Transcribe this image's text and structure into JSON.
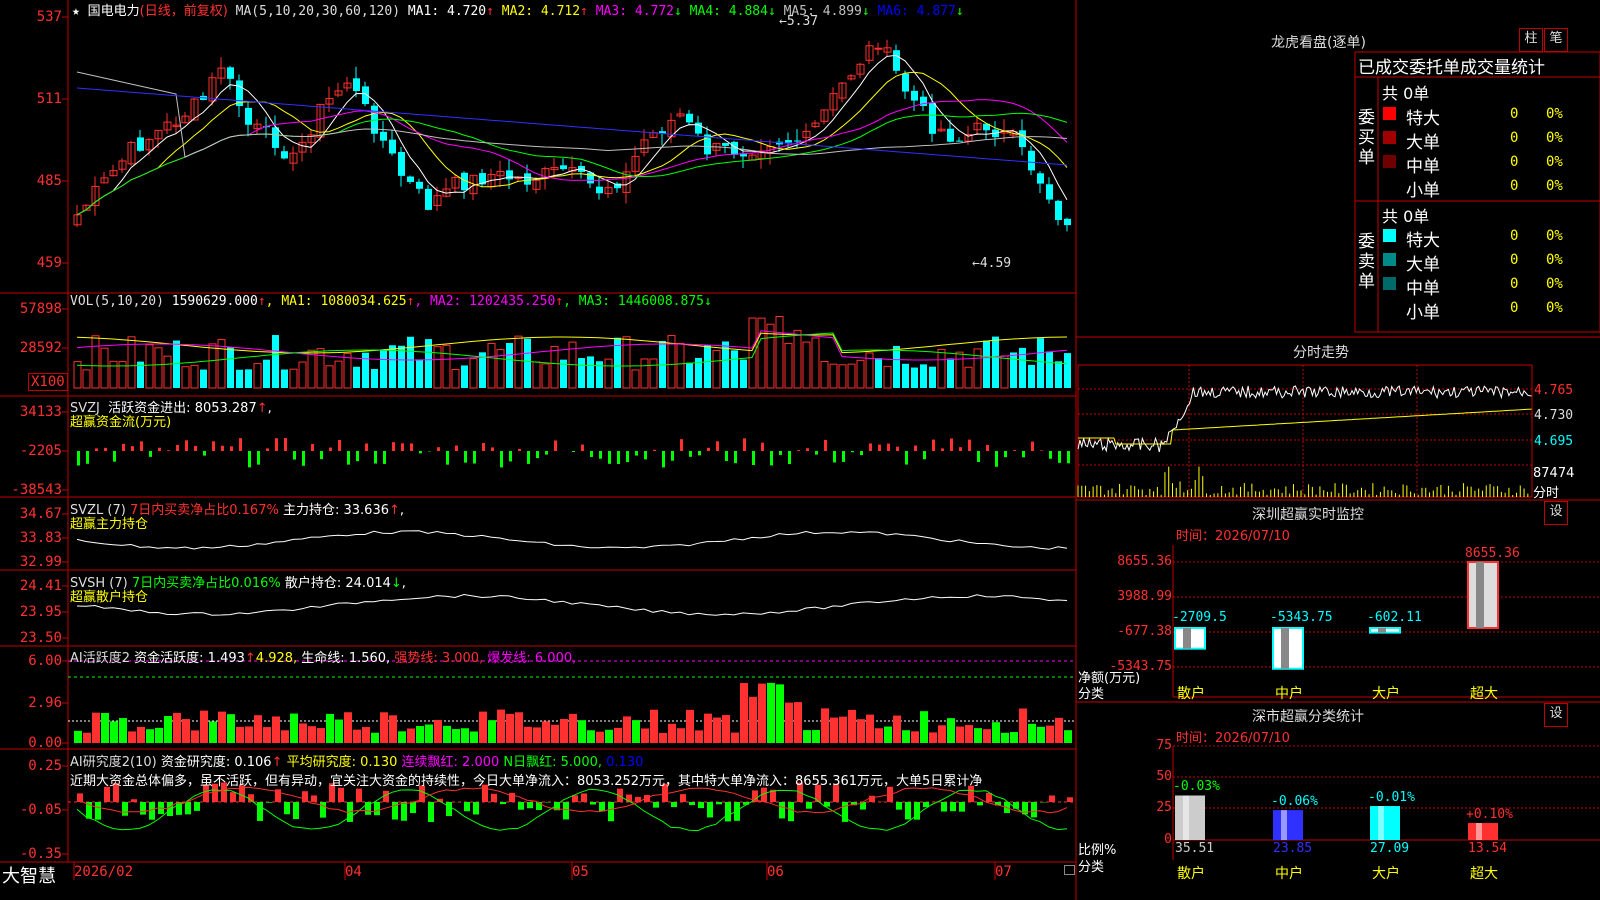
{
  "main_chart": {
    "star_icon": "★",
    "name": "国电电力",
    "period": "(日线，前复权)",
    "ma_params": "MA(5,10,20,30,60,120)",
    "ma": [
      {
        "label": "MA1:",
        "value": "4.720",
        "arrow": "↑",
        "color": "#ffffff"
      },
      {
        "label": "MA2:",
        "value": "4.712",
        "arrow": "↑",
        "color": "#ffff00"
      },
      {
        "label": "MA3:",
        "value": "4.772",
        "arrow": "↓",
        "color": "#ff00ff"
      },
      {
        "label": "MA4:",
        "value": "4.884",
        "arrow": "↓",
        "color": "#00ff00"
      },
      {
        "label": "MA5:",
        "value": "4.899",
        "arrow": "↓",
        "color": "#c0c0c0"
      },
      {
        "label": "MA6:",
        "value": "4.877",
        "arrow": "↓",
        "color": "#0000ff"
      }
    ],
    "high_note": "←5.37",
    "low_note": "←4.59",
    "yticks": [
      "537",
      "511",
      "485",
      "459"
    ]
  },
  "vol": {
    "params": "VOL(5,10,20)",
    "value": "1590629.000",
    "arrow": "↑",
    "ma": [
      {
        "label": "MA1:",
        "value": "1080034.625",
        "arrow": "↑",
        "color": "#ffff00"
      },
      {
        "label": "MA2:",
        "value": "1202435.250",
        "arrow": "↑",
        "color": "#ff00ff"
      },
      {
        "label": "MA3:",
        "value": "1446008.875",
        "arrow": "↓",
        "color": "#00ff00"
      }
    ],
    "yticks": [
      "57898",
      "28592"
    ],
    "unit": "X100"
  },
  "svzj": {
    "name": "SVZJ",
    "label": "活跃资金进出:",
    "value": "8053.287",
    "arrow": "↑",
    "tail": ",",
    "sub": "超赢资金流(万元)",
    "yticks": [
      "34133",
      "-2205",
      "-38543"
    ]
  },
  "svzl": {
    "name": "SVZL (7)",
    "ratio_label": "7日内买卖净占比0.167%",
    "label": "主力持仓:",
    "value": "33.636",
    "arrow": "↑",
    "tail": ",",
    "sub": "超赢主力持仓",
    "yticks": [
      "34.67",
      "33.83",
      "32.99"
    ]
  },
  "svsh": {
    "name": "SVSH (7)",
    "ratio_label": "7日内买卖净占比0.016%",
    "label": "散户持仓:",
    "value": "24.014",
    "arrow": "↓",
    "tail": ",",
    "sub": "超赢散户持仓",
    "yticks": [
      "24.41",
      "23.95",
      "23.50"
    ]
  },
  "ai_active": {
    "name": "AI活跃度2",
    "label": "资金活跃度:",
    "value": "1.493",
    "arrow": "↑",
    "value2": "4.928,",
    "life_label": "生命线:",
    "life_value": "1.560,",
    "strong_label": "强势线:",
    "strong_value": "3.000,",
    "burst_label": "爆发线:",
    "burst_value": "6.000,",
    "yticks": [
      "6.00",
      "2.96",
      "0.00"
    ]
  },
  "ai_research": {
    "name": "AI研究度2(10)",
    "label": "资金研究度:",
    "value": "0.106",
    "arrow": "↑",
    "avg_label": "平均研究度:",
    "avg_value": "0.130",
    "red_label": "连续飘红:",
    "red_value": "2.000",
    "nred_label": "N日飘红:",
    "nred_value": "5.000,",
    "nred_extra": "0.130",
    "comment": "近期大资金总体偏多，虽不活跃，但有异动，宜关注大资金的持续性，今日大单净流入：8053.252万元，其中特大单净流入：8655.361万元，大单5日累计净",
    "yticks": [
      "0.25",
      "-0.05",
      "-0.35"
    ]
  },
  "xaxis": {
    "brand": "大智慧",
    "labels": [
      "2026/02",
      "04",
      "05",
      "06",
      "07"
    ]
  },
  "right": {
    "dragon": "龙虎看盘(逐单)",
    "btn_col": "柱",
    "btn_pen": "笔",
    "stat_title": "已成交委托单成交量统计",
    "buy": {
      "side_label": "委买单",
      "total": "共 0单",
      "rows": [
        {
          "name": "特大",
          "count": "0",
          "pct": "0%",
          "color": "#ff0000"
        },
        {
          "name": "大单",
          "count": "0",
          "pct": "0%",
          "color": "#a00000"
        },
        {
          "name": "中单",
          "count": "0",
          "pct": "0%",
          "color": "#700000"
        },
        {
          "name": "小单",
          "count": "0",
          "pct": "0%",
          "color": ""
        }
      ]
    },
    "sell": {
      "side_label": "委卖单",
      "total": "共 0单",
      "rows": [
        {
          "name": "特大",
          "count": "0",
          "pct": "0%",
          "color": "#00ffff"
        },
        {
          "name": "大单",
          "count": "0",
          "pct": "0%",
          "color": "#008b8b"
        },
        {
          "name": "中单",
          "count": "0",
          "pct": "0%",
          "color": "#006a6a"
        },
        {
          "name": "小单",
          "count": "0",
          "pct": "0%",
          "color": ""
        }
      ]
    },
    "intraday": {
      "title": "分时走势",
      "yticks": [
        "4.765",
        "4.730",
        "4.695"
      ],
      "vol_label": "87474",
      "vol_unit": "分时"
    },
    "monitor": {
      "title": "深圳超赢实时监控",
      "set": "设",
      "time": "时间：2026/07/10",
      "yticks": [
        "8655.36",
        "3988.99",
        "-677.38",
        "-5343.75"
      ],
      "net_label": "净额(万元)",
      "cat_label": "分类",
      "categories": [
        "散户",
        "中户",
        "大户",
        "超大"
      ],
      "values": [
        -2709.5,
        -5343.75,
        -602.11,
        8655.36
      ],
      "value_labels": [
        "-2709.5",
        "-5343.75",
        "-602.11",
        "8655.36"
      ],
      "ylim": [
        -5343.75,
        8655.36
      ]
    },
    "classify": {
      "title": "深市超赢分类统计",
      "set": "设",
      "time": "时间：2026/07/10",
      "yticks": [
        "75",
        "50",
        "25",
        "0"
      ],
      "ratio_label": "比例%",
      "cat_label": "分类",
      "categories": [
        "散户",
        "中户",
        "大户",
        "超大"
      ],
      "values": [
        35.51,
        23.85,
        27.09,
        13.54
      ],
      "value_labels": [
        "35.51",
        "23.85",
        "27.09",
        "13.54"
      ],
      "changes": [
        "-0.03%",
        "-0.06%",
        "-0.01%",
        "+0.10%"
      ],
      "bar_colors": [
        "#cccccc",
        "#3030ff",
        "#00ffff",
        "#ff3030"
      ],
      "change_colors": [
        "#00ff00",
        "#00ffff",
        "#00ffff",
        "#ff3030"
      ],
      "ylim": [
        0,
        75
      ]
    }
  },
  "colors": {
    "up": "#ff3030",
    "down": "#00ffff",
    "grid": "#c00000",
    "axis_text": "#ff3030"
  }
}
